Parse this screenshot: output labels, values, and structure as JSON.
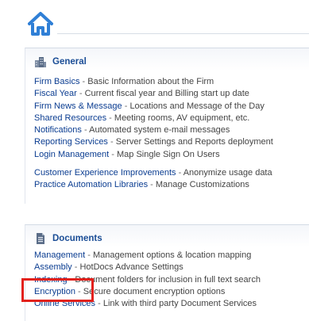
{
  "header": {
    "home_icon": "home-icon"
  },
  "general": {
    "title": "General",
    "icon": "buildings-icon",
    "items": [
      {
        "label": "Firm Basics",
        "desc": "Basic Information about the Firm"
      },
      {
        "label": "Fiscal Year",
        "desc": "Current fiscal year and Billing start up date"
      },
      {
        "label": "Firm News & Message",
        "desc": "Locations and Message of the Day"
      },
      {
        "label": "Shared Resources",
        "desc": "Meeting rooms, AV equipment, etc."
      },
      {
        "label": "Notifications",
        "desc": "Automated system e-mail messages"
      },
      {
        "label": "Reporting Services",
        "desc": "Server Settings and Reports deployment"
      },
      {
        "label": "Login Management",
        "desc": "Map Single Sign On Users"
      },
      {
        "label": "Customer Experience Improvements",
        "desc": "Anonymize usage data"
      },
      {
        "label": "Practice Automation Libraries",
        "desc": "Manage Customizations"
      }
    ]
  },
  "documents": {
    "title": "Documents",
    "icon": "document-icon",
    "items": [
      {
        "label": "Management",
        "desc": "Management options & location mapping"
      },
      {
        "label": "Assembly",
        "desc": "HotDocs Advance Settings"
      },
      {
        "label": "Indexing",
        "desc": "Document folders for inclusion in full text search"
      },
      {
        "label": "Encryption",
        "desc": "Secure document encryption options"
      },
      {
        "label": "Online Services",
        "desc": "Link with third party Document Services"
      }
    ]
  },
  "separator": "-",
  "colors": {
    "link": "#0b3d91",
    "title": "#1a4d96",
    "home_blue": "#2f7fd6",
    "highlight": "#e2211c"
  }
}
